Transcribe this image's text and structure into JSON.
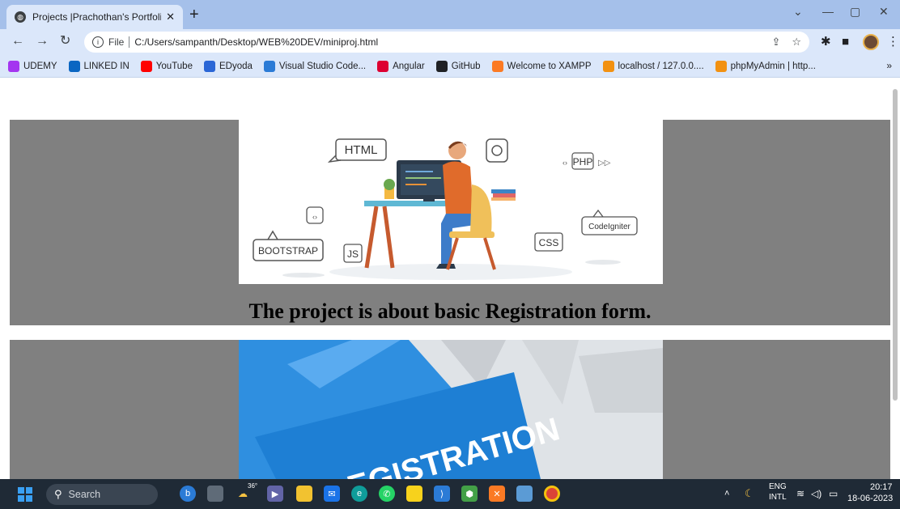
{
  "browser": {
    "tab_title": "Projects |Prachothan's Portfolio",
    "tab_close": "✕",
    "new_tab": "+",
    "url_chip": "File",
    "url": "C:/Users/sampanth/Desktop/WEB%20DEV/miniproj.html",
    "window_controls": [
      "minimize-icon",
      "maximize-icon",
      "close-icon"
    ],
    "bookmarks": [
      {
        "label": "UDEMY",
        "icon": "udemy-icon",
        "color": "#a435f0"
      },
      {
        "label": "LINKED IN",
        "icon": "linkedin-icon",
        "color": "#0a66c2"
      },
      {
        "label": "YouTube",
        "icon": "youtube-icon",
        "color": "#ff0000"
      },
      {
        "label": "EDyoda",
        "icon": "edyoda-icon",
        "color": "#2a66d6"
      },
      {
        "label": "Visual Studio Code...",
        "icon": "vscode-icon",
        "color": "#2b7bd6"
      },
      {
        "label": "Angular",
        "icon": "angular-icon",
        "color": "#dd0031"
      },
      {
        "label": "GitHub",
        "icon": "github-icon",
        "color": "#202124"
      },
      {
        "label": "Welcome to XAMPP",
        "icon": "xampp-icon",
        "color": "#fb7a24"
      },
      {
        "label": "localhost / 127.0.0....",
        "icon": "phpmyadmin-icon",
        "color": "#f29111"
      },
      {
        "label": "phpMyAdmin | http...",
        "icon": "phpmyadmin-icon",
        "color": "#f29111"
      }
    ],
    "bookmarks_more": "»"
  },
  "page": {
    "project1": {
      "caption": "The project is about basic Registration form.",
      "illustration_labels": [
        "HTML",
        "PHP",
        "CodeIgniter",
        "BOOTSTRAP",
        "JS",
        "CSS"
      ]
    },
    "project2": {
      "image_text": "REGISTRATION"
    }
  },
  "taskbar": {
    "search_label": "Search",
    "weather": "36°",
    "lang_top": "ENG",
    "lang_bottom": "INTL",
    "time": "20:17",
    "date": "18-06-2023"
  },
  "colors": {
    "card_bg": "#808080",
    "tab_strip": "#a5c0ea",
    "toolbar": "#dbe7fa",
    "taskbar": "#1f2a36"
  }
}
